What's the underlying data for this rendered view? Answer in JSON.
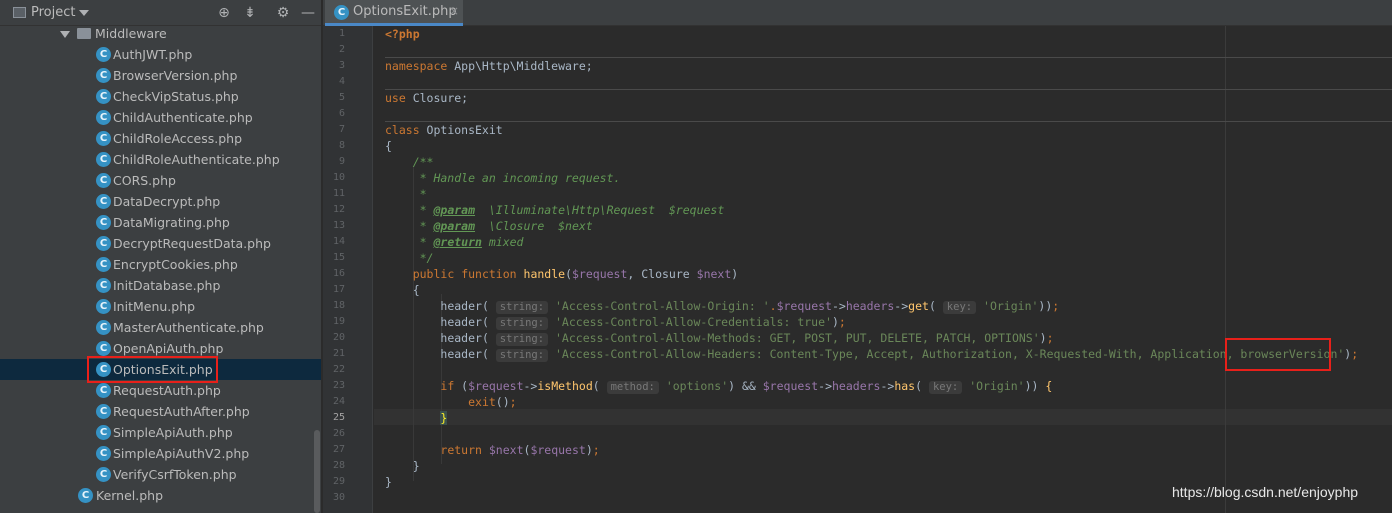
{
  "project_panel": {
    "title": "Project",
    "tools": [
      "locate-icon",
      "collapse-icon",
      "gear-icon",
      "hide-icon"
    ],
    "folder": "Middleware",
    "files": [
      "AuthJWT.php",
      "BrowserVersion.php",
      "CheckVipStatus.php",
      "ChildAuthenticate.php",
      "ChildRoleAccess.php",
      "ChildRoleAuthenticate.php",
      "CORS.php",
      "DataDecrypt.php",
      "DataMigrating.php",
      "DecryptRequestData.php",
      "EncryptCookies.php",
      "InitDatabase.php",
      "InitMenu.php",
      "MasterAuthenticate.php",
      "OpenApiAuth.php",
      "OptionsExit.php",
      "RequestAuth.php",
      "RequestAuthAfter.php",
      "SimpleApiAuth.php",
      "SimpleApiAuthV2.php",
      "VerifyCsrfToken.php"
    ],
    "selected_file": "OptionsExit.php",
    "kernel_file": "Kernel.php",
    "file_icon_letter": "C"
  },
  "editor": {
    "tab_label": "OptionsExit.php",
    "tab_close": "×",
    "current_line": 25,
    "line_numbers": [
      "1",
      "2",
      "3",
      "4",
      "5",
      "6",
      "7",
      "8",
      "9",
      "10",
      "11",
      "12",
      "13",
      "14",
      "15",
      "16",
      "17",
      "18",
      "19",
      "20",
      "21",
      "22",
      "23",
      "24",
      "25",
      "26",
      "27",
      "28",
      "29",
      "30"
    ],
    "code": {
      "l1": "<?php",
      "l3_kw": "namespace",
      "l3_rest": " App\\Http\\Middleware;",
      "l5_kw": "use",
      "l5_rest": " Closure;",
      "l7_kw": "class",
      "l7_rest": " OptionsExit",
      "l8": "{",
      "l9": "    /**",
      "l10": "     * Handle an incoming request.",
      "l11": "     *",
      "l12_a": "     * ",
      "l12_tag": "@param",
      "l12_b": "  \\Illuminate\\Http\\Request  $request",
      "l13_a": "     * ",
      "l13_tag": "@param",
      "l13_b": "  \\Closure  $next",
      "l14_a": "     * ",
      "l14_tag": "@return",
      "l14_b": " mixed",
      "l15": "     */",
      "l16_kw1": "public",
      "l16_kw2": "function",
      "l16_fn": "handle",
      "l16_var1": "$request",
      "l16_mid": ", Closure ",
      "l16_var2": "$next",
      "l17": "    {",
      "header_fn": "header",
      "hint_string": "string:",
      "hint_key": "key:",
      "hint_method": "method:",
      "l18_str": "'Access-Control-Allow-Origin: '",
      "l18_var": "$request",
      "l18_prop": "headers",
      "l18_get": "get",
      "l18_key": "'Origin'",
      "l19_str": "'Access-Control-Allow-Credentials: true'",
      "l20_str": "'Access-Control-Allow-Methods: GET, POST, PUT, DELETE, PATCH, OPTIONS'",
      "l21_str": "'Access-Control-Allow-Headers: Content-Type, Accept, Authorization, X-Requested-With, Application, browserVersion'",
      "l23_kw": "if",
      "l23_var": "$request",
      "l23_fn": "isMethod",
      "l23_str": "'options'",
      "l23_var2": "$request",
      "l23_prop": "headers",
      "l23_fn2": "has",
      "l23_key": "'Origin'",
      "l24_kw": "exit",
      "l25": "}",
      "l27_kw": "return",
      "l27_var": "$next",
      "l27_var2": "$request",
      "l28": "    }",
      "l29": "}"
    }
  },
  "watermark": "https://blog.csdn.net/enjoyphp"
}
